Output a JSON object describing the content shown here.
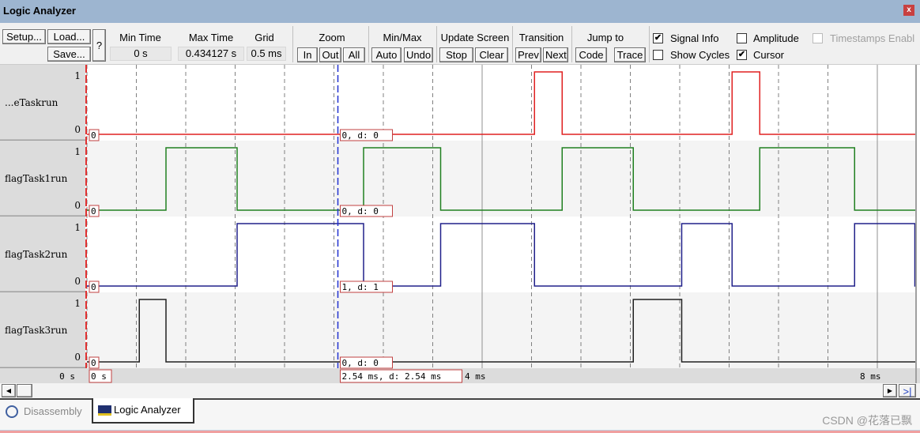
{
  "window": {
    "title": "Logic Analyzer",
    "close_icon": "close-icon"
  },
  "toolbar": {
    "setup": "Setup...",
    "load": "Load...",
    "save": "Save...",
    "help": "?",
    "min_time_label": "Min Time",
    "min_time": "0 s",
    "max_time_label": "Max Time",
    "max_time": "0.434127 s",
    "grid_label": "Grid",
    "grid": "0.5 ms",
    "zoom_label": "Zoom",
    "zoom_in": "In",
    "zoom_out": "Out",
    "zoom_all": "All",
    "minmax_label": "Min/Max",
    "auto": "Auto",
    "undo": "Undo",
    "update_label": "Update Screen",
    "stop": "Stop",
    "clear": "Clear",
    "transition_label": "Transition",
    "prev": "Prev",
    "next": "Next",
    "jump_label": "Jump to",
    "code": "Code",
    "trace": "Trace",
    "signal_info": {
      "label": "Signal Info",
      "checked": true
    },
    "show_cycles": {
      "label": "Show Cycles",
      "checked": false
    },
    "amplitude": {
      "label": "Amplitude",
      "checked": false
    },
    "cursor": {
      "label": "Cursor",
      "checked": true
    },
    "timestamps": {
      "label": "Timestamps Enabl",
      "checked": false,
      "disabled": true
    }
  },
  "chart_data": {
    "type": "line",
    "xunit": "ms",
    "xlim": [
      0,
      8.38
    ],
    "grid_ms": 0.5,
    "cursor_ms": 2.54,
    "axis_labels": [
      {
        "t": 0,
        "text": "0 s"
      },
      {
        "t": 4,
        "text": "4 ms"
      },
      {
        "t": 8,
        "text": "8 ms"
      }
    ],
    "start_label": "0 s",
    "cursor_label": "2.54 ms,   d: 2.54 ms",
    "signals": [
      {
        "name": "...eTaskrun",
        "color": "#e02020",
        "high": "1",
        "low": "0",
        "start_value": "0",
        "cursor_value": "0,   d: 0",
        "pulses": [
          [
            4.53,
            4.81
          ],
          [
            6.53,
            6.81
          ]
        ]
      },
      {
        "name": "flagTask1run",
        "color": "#208020",
        "high": "1",
        "low": "0",
        "start_value": "0",
        "cursor_value": "0,   d: 0",
        "pulses": [
          [
            0.8,
            1.52
          ],
          [
            2.8,
            3.58
          ],
          [
            4.81,
            5.53
          ],
          [
            6.81,
            7.77
          ]
        ]
      },
      {
        "name": "flagTask2run",
        "color": "#20208a",
        "high": "1",
        "low": "0",
        "start_value": "0",
        "cursor_value": "1,   d: 1",
        "pulses": [
          [
            1.52,
            2.8
          ],
          [
            3.58,
            4.53
          ],
          [
            6.02,
            6.53
          ],
          [
            7.77,
            8.38
          ]
        ]
      },
      {
        "name": "flagTask3run",
        "color": "#202020",
        "high": "1",
        "low": "0",
        "start_value": "0",
        "cursor_value": "0,   d: 0",
        "pulses": [
          [
            0.53,
            0.8
          ],
          [
            5.53,
            6.02
          ]
        ]
      }
    ]
  },
  "tabs": [
    {
      "label": "Disassembly",
      "icon": "disassembly-icon",
      "active": false
    },
    {
      "label": "Logic Analyzer",
      "icon": "logic-analyzer-icon",
      "active": true
    }
  ],
  "watermark": "CSDN @花落已飘"
}
